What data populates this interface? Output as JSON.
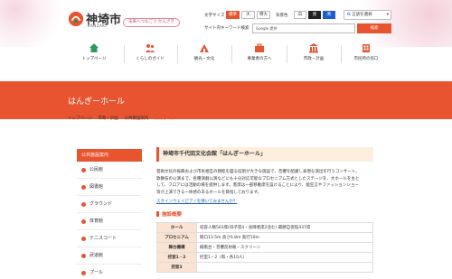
{
  "header": {
    "logo_text": "神埼市",
    "logo_sub": "KANZAKI",
    "tagline": "未来へつなごう かんざき",
    "font_size_label": "文字サイズ",
    "font_sizes": [
      "標準",
      "大",
      "特大"
    ],
    "color_label": "背景色",
    "colors": [
      "白",
      "黒",
      "青"
    ],
    "language_select": "言語を選択",
    "search_label": "サイト内キーワード検索",
    "search_placeholder": "Google 提供",
    "search_button": "検索"
  },
  "gnav": [
    {
      "label": "トップページ",
      "icon": "home-icon"
    },
    {
      "label": "くらしのガイド",
      "icon": "people-icon"
    },
    {
      "label": "観光・文化",
      "icon": "sightseeing-icon"
    },
    {
      "label": "事業者の方へ",
      "icon": "business-icon"
    },
    {
      "label": "市政・計画",
      "icon": "city-hall-icon"
    },
    {
      "label": "市民所の窓口",
      "icon": "building-icon"
    }
  ],
  "page_title": "はんぎーホール",
  "breadcrumb": [
    "トップページ",
    "市政・計画",
    "公共施設案内",
    "はんぎーホール"
  ],
  "sidebar": {
    "heading": "公共施設案内",
    "items": [
      "公民館",
      "図書館",
      "グラウンド",
      "体育館",
      "テニスコート",
      "武道館",
      "プール"
    ]
  },
  "content": {
    "heading": "神埼市千代田文化会館「はんぎーホール」",
    "intro": "芸術文化の振興および市民相互の親睦を図る役割が大きな施設で、音響を配慮し表現な演出を行うコンサート、歌舞伎の公演まで、各種演劇公演などにも十分対応可能なプロセニアム方式としたステージを、大ホールを主として、フロアには活動の場を提供します。客席は一部移動席を設けることにより、能狂言やファッションショー等が上演できる一体感のあるホールを目指しております。",
    "link": "スタインウェイピアノを弾いてみませんか？",
    "section": "施設概要",
    "table": [
      {
        "label": "ホール",
        "value": "収容人数503席(母子席4・身障者席2含む) 最勝自習館437席"
      },
      {
        "label": "プロセニアム",
        "value": "間口13.5m 高さ6.8m 奥行10m"
      },
      {
        "label": "舞台機構",
        "value": "緞帳台・音響反射板・スクリーン"
      },
      {
        "label": "控室1・2",
        "value": "控室1・2（和・各10人）"
      },
      {
        "label": "控室3",
        "value": ""
      }
    ]
  },
  "colors": {
    "accent": "#e8542f",
    "accent_light": "#fdeedd",
    "link": "#1a5bb5"
  }
}
